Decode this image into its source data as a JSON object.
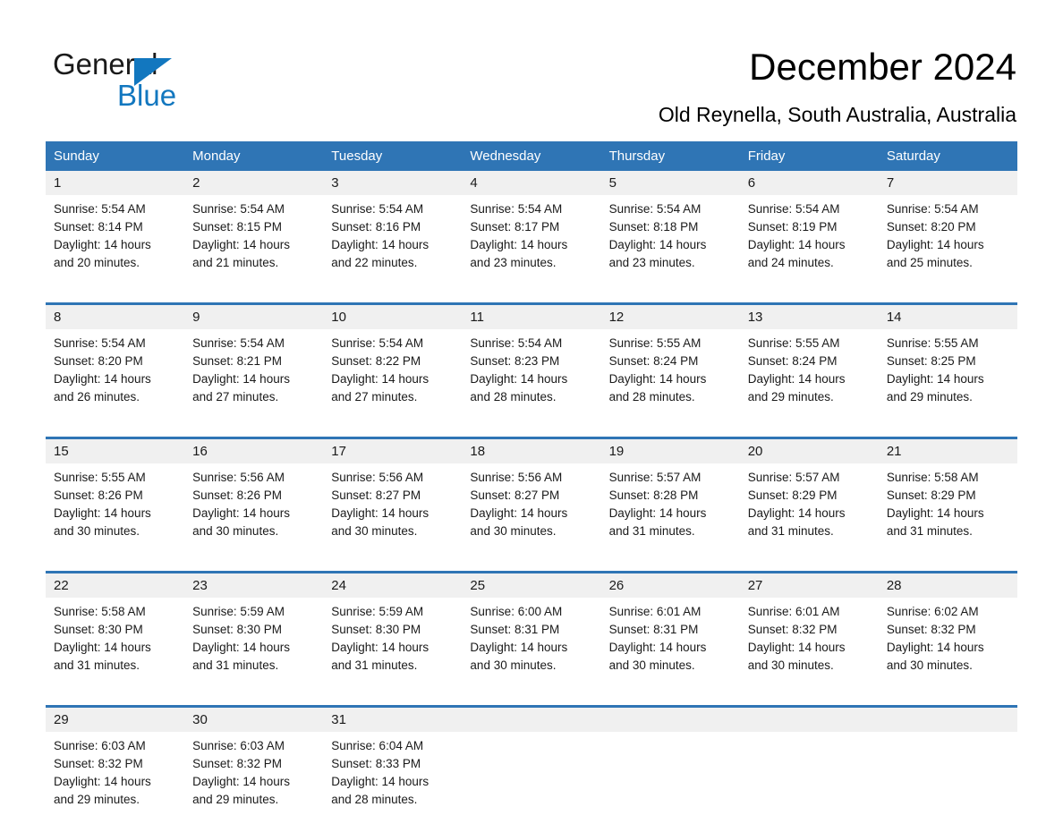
{
  "brand": {
    "word1": "General",
    "word2": "Blue",
    "accent_color": "#1277bf"
  },
  "header": {
    "title": "December 2024",
    "subtitle": "Old Reynella, South Australia, Australia"
  },
  "theme": {
    "header_bg": "#2f75b5",
    "daynum_bg": "#f0f0f0",
    "cell_bg": "#ffffff",
    "text": "#1a1a1a"
  },
  "weekday_headers": [
    "Sunday",
    "Monday",
    "Tuesday",
    "Wednesday",
    "Thursday",
    "Friday",
    "Saturday"
  ],
  "weeks": [
    [
      {
        "day": "1",
        "sunrise": "Sunrise: 5:54 AM",
        "sunset": "Sunset: 8:14 PM",
        "daylight1": "Daylight: 14 hours",
        "daylight2": "and 20 minutes."
      },
      {
        "day": "2",
        "sunrise": "Sunrise: 5:54 AM",
        "sunset": "Sunset: 8:15 PM",
        "daylight1": "Daylight: 14 hours",
        "daylight2": "and 21 minutes."
      },
      {
        "day": "3",
        "sunrise": "Sunrise: 5:54 AM",
        "sunset": "Sunset: 8:16 PM",
        "daylight1": "Daylight: 14 hours",
        "daylight2": "and 22 minutes."
      },
      {
        "day": "4",
        "sunrise": "Sunrise: 5:54 AM",
        "sunset": "Sunset: 8:17 PM",
        "daylight1": "Daylight: 14 hours",
        "daylight2": "and 23 minutes."
      },
      {
        "day": "5",
        "sunrise": "Sunrise: 5:54 AM",
        "sunset": "Sunset: 8:18 PM",
        "daylight1": "Daylight: 14 hours",
        "daylight2": "and 23 minutes."
      },
      {
        "day": "6",
        "sunrise": "Sunrise: 5:54 AM",
        "sunset": "Sunset: 8:19 PM",
        "daylight1": "Daylight: 14 hours",
        "daylight2": "and 24 minutes."
      },
      {
        "day": "7",
        "sunrise": "Sunrise: 5:54 AM",
        "sunset": "Sunset: 8:20 PM",
        "daylight1": "Daylight: 14 hours",
        "daylight2": "and 25 minutes."
      }
    ],
    [
      {
        "day": "8",
        "sunrise": "Sunrise: 5:54 AM",
        "sunset": "Sunset: 8:20 PM",
        "daylight1": "Daylight: 14 hours",
        "daylight2": "and 26 minutes."
      },
      {
        "day": "9",
        "sunrise": "Sunrise: 5:54 AM",
        "sunset": "Sunset: 8:21 PM",
        "daylight1": "Daylight: 14 hours",
        "daylight2": "and 27 minutes."
      },
      {
        "day": "10",
        "sunrise": "Sunrise: 5:54 AM",
        "sunset": "Sunset: 8:22 PM",
        "daylight1": "Daylight: 14 hours",
        "daylight2": "and 27 minutes."
      },
      {
        "day": "11",
        "sunrise": "Sunrise: 5:54 AM",
        "sunset": "Sunset: 8:23 PM",
        "daylight1": "Daylight: 14 hours",
        "daylight2": "and 28 minutes."
      },
      {
        "day": "12",
        "sunrise": "Sunrise: 5:55 AM",
        "sunset": "Sunset: 8:24 PM",
        "daylight1": "Daylight: 14 hours",
        "daylight2": "and 28 minutes."
      },
      {
        "day": "13",
        "sunrise": "Sunrise: 5:55 AM",
        "sunset": "Sunset: 8:24 PM",
        "daylight1": "Daylight: 14 hours",
        "daylight2": "and 29 minutes."
      },
      {
        "day": "14",
        "sunrise": "Sunrise: 5:55 AM",
        "sunset": "Sunset: 8:25 PM",
        "daylight1": "Daylight: 14 hours",
        "daylight2": "and 29 minutes."
      }
    ],
    [
      {
        "day": "15",
        "sunrise": "Sunrise: 5:55 AM",
        "sunset": "Sunset: 8:26 PM",
        "daylight1": "Daylight: 14 hours",
        "daylight2": "and 30 minutes."
      },
      {
        "day": "16",
        "sunrise": "Sunrise: 5:56 AM",
        "sunset": "Sunset: 8:26 PM",
        "daylight1": "Daylight: 14 hours",
        "daylight2": "and 30 minutes."
      },
      {
        "day": "17",
        "sunrise": "Sunrise: 5:56 AM",
        "sunset": "Sunset: 8:27 PM",
        "daylight1": "Daylight: 14 hours",
        "daylight2": "and 30 minutes."
      },
      {
        "day": "18",
        "sunrise": "Sunrise: 5:56 AM",
        "sunset": "Sunset: 8:27 PM",
        "daylight1": "Daylight: 14 hours",
        "daylight2": "and 30 minutes."
      },
      {
        "day": "19",
        "sunrise": "Sunrise: 5:57 AM",
        "sunset": "Sunset: 8:28 PM",
        "daylight1": "Daylight: 14 hours",
        "daylight2": "and 31 minutes."
      },
      {
        "day": "20",
        "sunrise": "Sunrise: 5:57 AM",
        "sunset": "Sunset: 8:29 PM",
        "daylight1": "Daylight: 14 hours",
        "daylight2": "and 31 minutes."
      },
      {
        "day": "21",
        "sunrise": "Sunrise: 5:58 AM",
        "sunset": "Sunset: 8:29 PM",
        "daylight1": "Daylight: 14 hours",
        "daylight2": "and 31 minutes."
      }
    ],
    [
      {
        "day": "22",
        "sunrise": "Sunrise: 5:58 AM",
        "sunset": "Sunset: 8:30 PM",
        "daylight1": "Daylight: 14 hours",
        "daylight2": "and 31 minutes."
      },
      {
        "day": "23",
        "sunrise": "Sunrise: 5:59 AM",
        "sunset": "Sunset: 8:30 PM",
        "daylight1": "Daylight: 14 hours",
        "daylight2": "and 31 minutes."
      },
      {
        "day": "24",
        "sunrise": "Sunrise: 5:59 AM",
        "sunset": "Sunset: 8:30 PM",
        "daylight1": "Daylight: 14 hours",
        "daylight2": "and 31 minutes."
      },
      {
        "day": "25",
        "sunrise": "Sunrise: 6:00 AM",
        "sunset": "Sunset: 8:31 PM",
        "daylight1": "Daylight: 14 hours",
        "daylight2": "and 30 minutes."
      },
      {
        "day": "26",
        "sunrise": "Sunrise: 6:01 AM",
        "sunset": "Sunset: 8:31 PM",
        "daylight1": "Daylight: 14 hours",
        "daylight2": "and 30 minutes."
      },
      {
        "day": "27",
        "sunrise": "Sunrise: 6:01 AM",
        "sunset": "Sunset: 8:32 PM",
        "daylight1": "Daylight: 14 hours",
        "daylight2": "and 30 minutes."
      },
      {
        "day": "28",
        "sunrise": "Sunrise: 6:02 AM",
        "sunset": "Sunset: 8:32 PM",
        "daylight1": "Daylight: 14 hours",
        "daylight2": "and 30 minutes."
      }
    ],
    [
      {
        "day": "29",
        "sunrise": "Sunrise: 6:03 AM",
        "sunset": "Sunset: 8:32 PM",
        "daylight1": "Daylight: 14 hours",
        "daylight2": "and 29 minutes."
      },
      {
        "day": "30",
        "sunrise": "Sunrise: 6:03 AM",
        "sunset": "Sunset: 8:32 PM",
        "daylight1": "Daylight: 14 hours",
        "daylight2": "and 29 minutes."
      },
      {
        "day": "31",
        "sunrise": "Sunrise: 6:04 AM",
        "sunset": "Sunset: 8:33 PM",
        "daylight1": "Daylight: 14 hours",
        "daylight2": "and 28 minutes."
      },
      {
        "day": "",
        "sunrise": "",
        "sunset": "",
        "daylight1": "",
        "daylight2": ""
      },
      {
        "day": "",
        "sunrise": "",
        "sunset": "",
        "daylight1": "",
        "daylight2": ""
      },
      {
        "day": "",
        "sunrise": "",
        "sunset": "",
        "daylight1": "",
        "daylight2": ""
      },
      {
        "day": "",
        "sunrise": "",
        "sunset": "",
        "daylight1": "",
        "daylight2": ""
      }
    ]
  ]
}
